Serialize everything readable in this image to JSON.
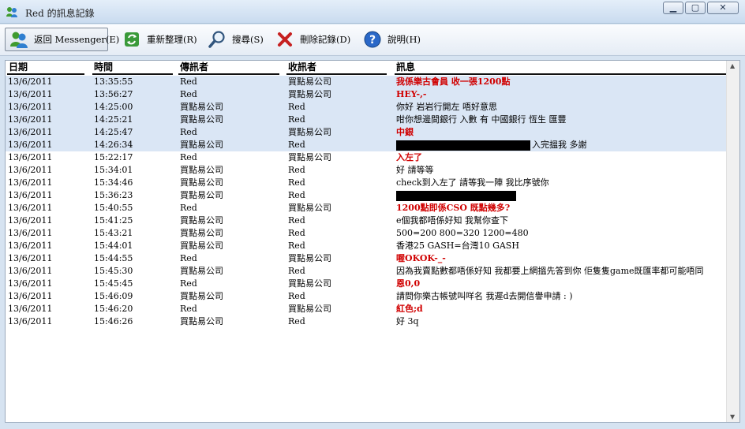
{
  "window": {
    "title": "Red 的訊息記錄",
    "minimize": "▁",
    "maximize": "▢",
    "close": "✕"
  },
  "toolbar": {
    "back": "返回 Messenger(E)",
    "refresh": "重新整理(R)",
    "search": "搜尋(S)",
    "delete": "刪除記錄(D)",
    "help": "說明(H)"
  },
  "columns": [
    "日期",
    "時間",
    "傳訊者",
    "收訊者",
    "訊息"
  ],
  "rows": [
    {
      "date": "13/6/2011",
      "time": "13:35:55",
      "from": "Red",
      "to": "買點易公司",
      "msg": "我係樂古會員 收一張1200點",
      "red": true,
      "hl": true
    },
    {
      "date": "13/6/2011",
      "time": "13:56:27",
      "from": "Red",
      "to": "買點易公司",
      "msg": "HEY-,-",
      "red": true,
      "hl": true
    },
    {
      "date": "13/6/2011",
      "time": "14:25:00",
      "from": "買點易公司",
      "to": "Red",
      "msg": "你好 岩岩行開左 唔好意思",
      "red": false,
      "hl": true
    },
    {
      "date": "13/6/2011",
      "time": "14:25:21",
      "from": "買點易公司",
      "to": "Red",
      "msg": "咁你想邊間銀行 入數 有 中國銀行 恆生 匯豐",
      "red": false,
      "hl": true
    },
    {
      "date": "13/6/2011",
      "time": "14:25:47",
      "from": "Red",
      "to": "買點易公司",
      "msg": "中銀",
      "red": true,
      "hl": true
    },
    {
      "date": "13/6/2011",
      "time": "14:26:34",
      "from": "買點易公司",
      "to": "Red",
      "msg": "入完搵我 多謝",
      "red": false,
      "hl": true,
      "redact": 170,
      "msgIndent": 172
    },
    {
      "date": "13/6/2011",
      "time": "15:22:17",
      "from": "Red",
      "to": "買點易公司",
      "msg": "入左了",
      "red": true,
      "hl": false
    },
    {
      "date": "13/6/2011",
      "time": "15:34:01",
      "from": "買點易公司",
      "to": "Red",
      "msg": "好 請等等",
      "red": false,
      "hl": false
    },
    {
      "date": "13/6/2011",
      "time": "15:34:46",
      "from": "買點易公司",
      "to": "Red",
      "msg": "check到入左了 請等我一陣 我比序號你",
      "red": false,
      "hl": false
    },
    {
      "date": "13/6/2011",
      "time": "15:36:23",
      "from": "買點易公司",
      "to": "Red",
      "msg": "",
      "red": false,
      "hl": false,
      "redact": 152
    },
    {
      "date": "13/6/2011",
      "time": "15:40:55",
      "from": "Red",
      "to": "買點易公司",
      "msg": "1200點即係CSO 既點幾多?",
      "red": true,
      "hl": false
    },
    {
      "date": "13/6/2011",
      "time": "15:41:25",
      "from": "買點易公司",
      "to": "Red",
      "msg": "e個我都唔係好知 我幫你查下",
      "red": false,
      "hl": false
    },
    {
      "date": "13/6/2011",
      "time": "15:43:21",
      "from": "買點易公司",
      "to": "Red",
      "msg": "500=200 800=320 1200=480",
      "red": false,
      "hl": false
    },
    {
      "date": "13/6/2011",
      "time": "15:44:01",
      "from": "買點易公司",
      "to": "Red",
      "msg": "香港25 GASH=台灣10 GASH",
      "red": false,
      "hl": false
    },
    {
      "date": "13/6/2011",
      "time": "15:44:55",
      "from": "Red",
      "to": "買點易公司",
      "msg": "喔OKOK-_-",
      "red": true,
      "hl": false
    },
    {
      "date": "13/6/2011",
      "time": "15:45:30",
      "from": "買點易公司",
      "to": "Red",
      "msg": "因為我賣點數都唔係好知 我都要上網搵先答到你 佢隻隻game既匯率都可能唔同",
      "red": false,
      "hl": false
    },
    {
      "date": "13/6/2011",
      "time": "15:45:45",
      "from": "Red",
      "to": "買點易公司",
      "msg": "恩0,0",
      "red": true,
      "hl": false
    },
    {
      "date": "13/6/2011",
      "time": "15:46:09",
      "from": "買點易公司",
      "to": "Red",
      "msg": "請問你樂古帳號叫咩名 我遲d去開信譽申請 : )",
      "red": false,
      "hl": false
    },
    {
      "date": "13/6/2011",
      "time": "15:46:20",
      "from": "Red",
      "to": "買點易公司",
      "msg": "紅色;d",
      "red": true,
      "hl": false
    },
    {
      "date": "13/6/2011",
      "time": "15:46:26",
      "from": "買點易公司",
      "to": "Red",
      "msg": "好 3q",
      "red": false,
      "hl": false
    }
  ],
  "icons": {
    "title": "msn-buddies-icon",
    "back": "msn-buddies-icon",
    "refresh": "refresh-icon",
    "search": "magnifier-icon",
    "delete": "red-x-icon",
    "help": "help-icon"
  },
  "colors": {
    "highlight_row": "#dae6f5",
    "red_text": "#d00000"
  }
}
